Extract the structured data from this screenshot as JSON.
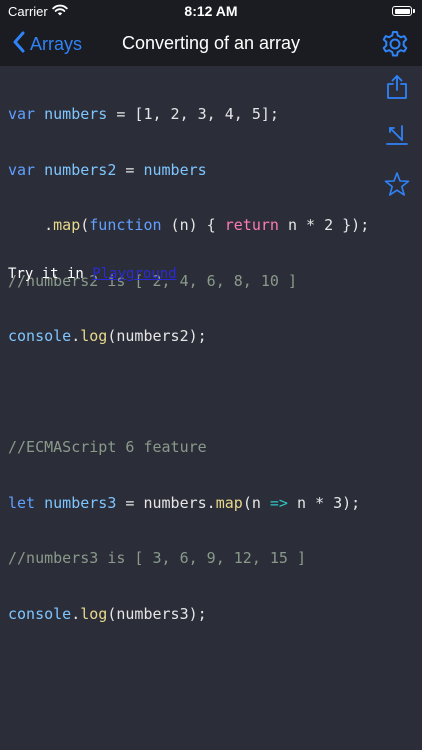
{
  "status": {
    "carrier": "Carrier",
    "time": "8:12 AM"
  },
  "nav": {
    "back_label": "Arrays",
    "title": "Converting of an array"
  },
  "code": {
    "l1": {
      "a": "var",
      "b": " numbers ",
      "c": "=",
      "d": " [1, 2, 3, 4, 5];"
    },
    "l2": {
      "a": "var",
      "b": " numbers2 ",
      "c": "=",
      "d": " numbers"
    },
    "l3": {
      "a": "    .",
      "b": "map",
      "c": "(",
      "d": "function",
      "e": " (n) { ",
      "f": "return",
      "g": " n ",
      "h": "*",
      "i": " 2 });"
    },
    "l4": "//numbers2 is [ 2, 4, 6, 8, 10 ]",
    "l5": {
      "a": "console",
      "b": ".",
      "c": "log",
      "d": "(numbers2);"
    },
    "l7": "//ECMAScript 6 feature",
    "l8": {
      "a": "let",
      "b": " numbers3 ",
      "c": "=",
      "d": " numbers.",
      "e": "map",
      "f": "(n ",
      "g": "=>",
      "h": " n ",
      "i": "*",
      "j": " 3);"
    },
    "l9": "//numbers3 is [ 3, 6, 9, 12, 15 ]",
    "l10": {
      "a": "console",
      "b": ".",
      "c": "log",
      "d": "(numbers3);"
    }
  },
  "try": {
    "prefix": "Try it in ",
    "link": "Playground"
  },
  "icons": {
    "back": "chevron-left-icon",
    "settings": "gear-icon",
    "share": "share-icon",
    "edit": "edit-icon",
    "favorite": "star-icon"
  },
  "colors": {
    "accent": "#2f83f7",
    "background": "#2b2d38",
    "bar": "#1b1c22",
    "link": "#2a2bd6"
  }
}
